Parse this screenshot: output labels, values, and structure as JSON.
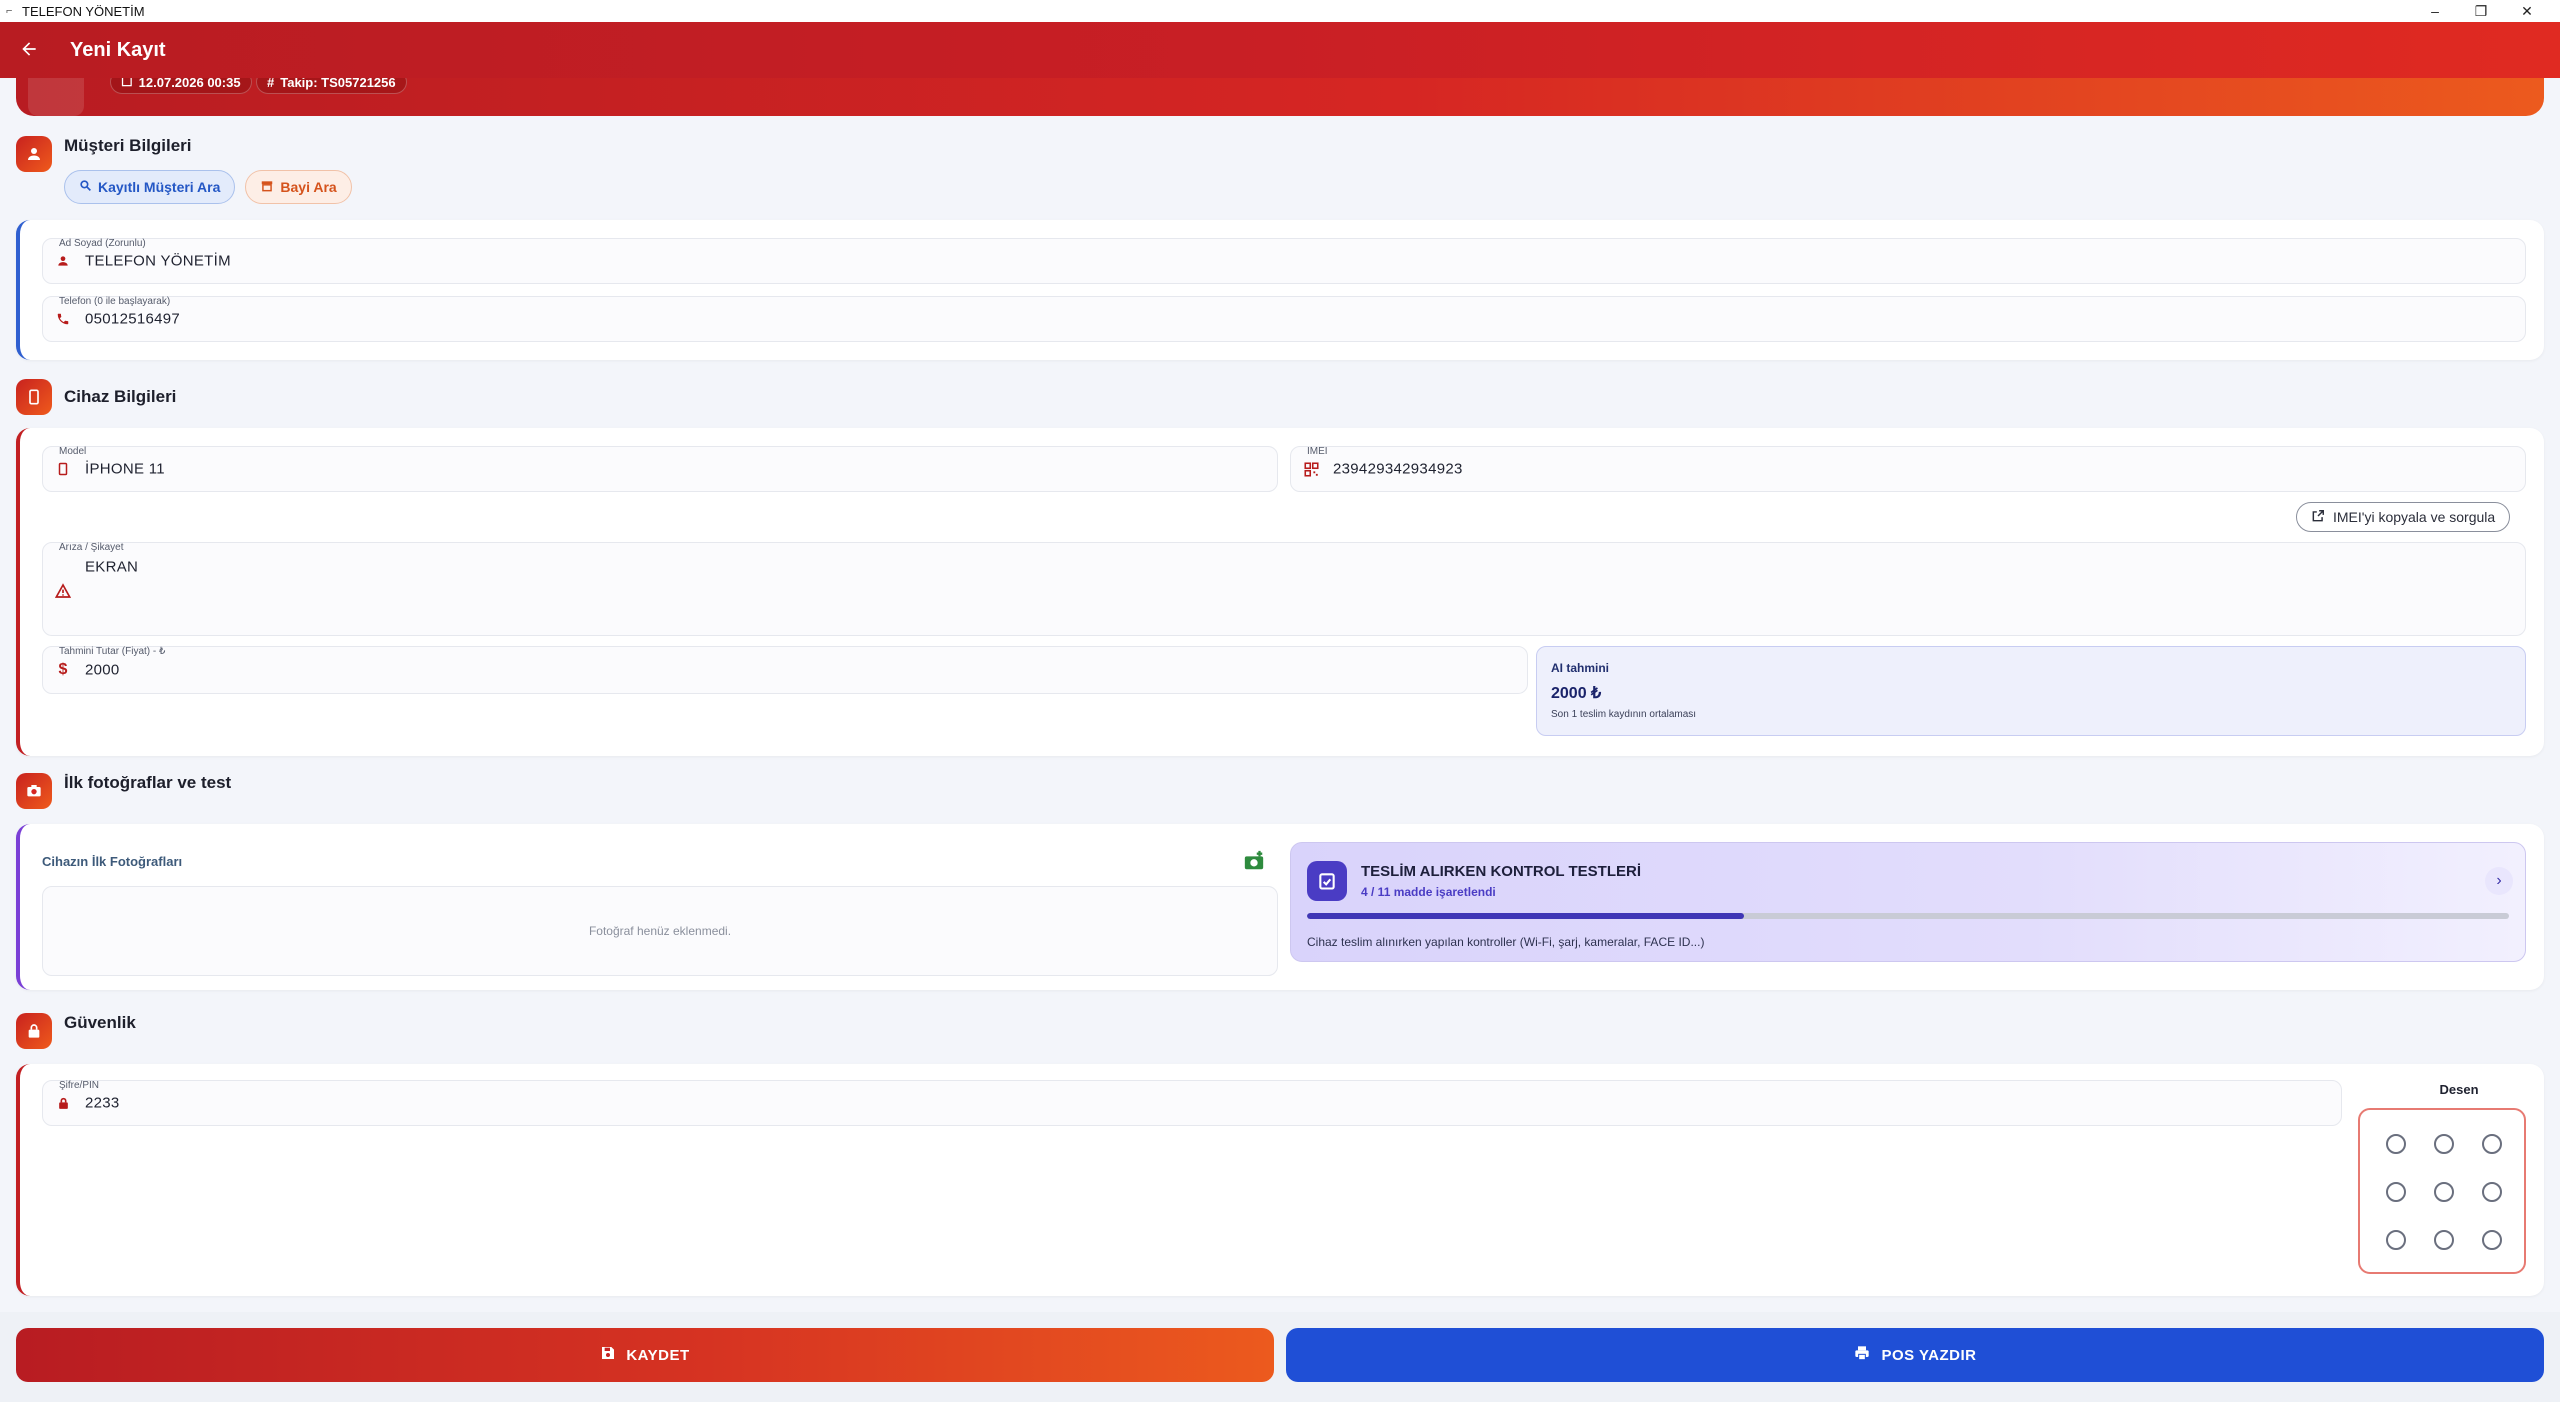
{
  "window": {
    "title": "TELEFON YÖNETİM",
    "controls": [
      "–",
      "❐",
      "✕"
    ]
  },
  "appbar": {
    "title": "Yeni Kayıt"
  },
  "header": {
    "date": "12.07.2026 00:35",
    "tracking": "Takip: TS05721256"
  },
  "customer_section": {
    "title": "Müşteri Bilgileri",
    "search_customer_label": "Kayıtlı Müşteri Ara",
    "search_dealer_label": "Bayi Ara",
    "name_label": "Ad Soyad (Zorunlu)",
    "name_value": "TELEFON YÖNETİM",
    "phone_label": "Telefon (0 ile başlayarak)",
    "phone_value": "05012516497"
  },
  "device_section": {
    "title": "Cihaz Bilgileri",
    "model_label": "Model",
    "model_value": "İPHONE 11",
    "imei_label": "IMEI",
    "imei_value": "239429342934923",
    "imei_button": "IMEI'yi kopyala ve sorgula",
    "fault_label": "Arıza / Şikayet",
    "fault_value": "EKRAN",
    "price_label": "Tahmini Tutar (Fiyat) - ₺",
    "price_value": "2000",
    "ai": {
      "title": "AI tahmini",
      "value": "2000 ₺",
      "note": "Son 1 teslim kaydının ortalaması"
    }
  },
  "photo_section": {
    "title": "İlk fotoğraflar ve test",
    "photos_title": "Cihazın İlk Fotoğrafları",
    "photos_empty": "Fotoğraf henüz eklenmedi.",
    "checks": {
      "title": "TESLİM ALIRKEN KONTROL TESTLERİ",
      "progress_text": "4 / 11 madde işaretlendi",
      "progress_done": 4,
      "progress_total": 11,
      "description": "Cihaz teslim alınırken yapılan kontroller (Wi-Fi, şarj, kameralar, FACE ID...)"
    }
  },
  "security_section": {
    "title": "Güvenlik",
    "pin_label": "Şifre/PIN",
    "pin_value": "2233",
    "pattern_label": "Desen"
  },
  "actions": {
    "save_label": "KAYDET",
    "print_label": "POS YAZDIR"
  },
  "colors": {
    "primary_red": "#c21f22",
    "accent_orange": "#ec5a1e",
    "blue": "#1f4fd6",
    "purple": "#4a3cc4"
  }
}
